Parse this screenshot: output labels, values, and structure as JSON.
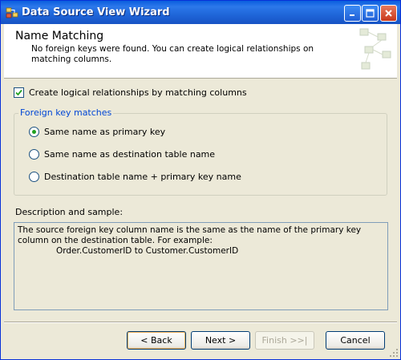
{
  "window": {
    "title": "Data Source View Wizard"
  },
  "header": {
    "title": "Name Matching",
    "description": "No foreign keys were found. You can create logical relationships on matching columns."
  },
  "options": {
    "create_relationships_label": "Create logical relationships by matching columns",
    "create_relationships_checked": true
  },
  "foreign_key_matches": {
    "label": "Foreign key matches",
    "items": [
      {
        "label": "Same name as primary key",
        "selected": true
      },
      {
        "label": "Same name as destination table name",
        "selected": false
      },
      {
        "label": "Destination table name + primary key name",
        "selected": false
      }
    ]
  },
  "description": {
    "label": "Description and sample:",
    "text": "The source foreign key column name is the same as the name of the primary key column on the destination table. For example:",
    "sample": "Order.CustomerID to Customer.CustomerID"
  },
  "buttons": {
    "back": "< Back",
    "next": "Next >",
    "finish": "Finish >>|",
    "cancel": "Cancel"
  }
}
